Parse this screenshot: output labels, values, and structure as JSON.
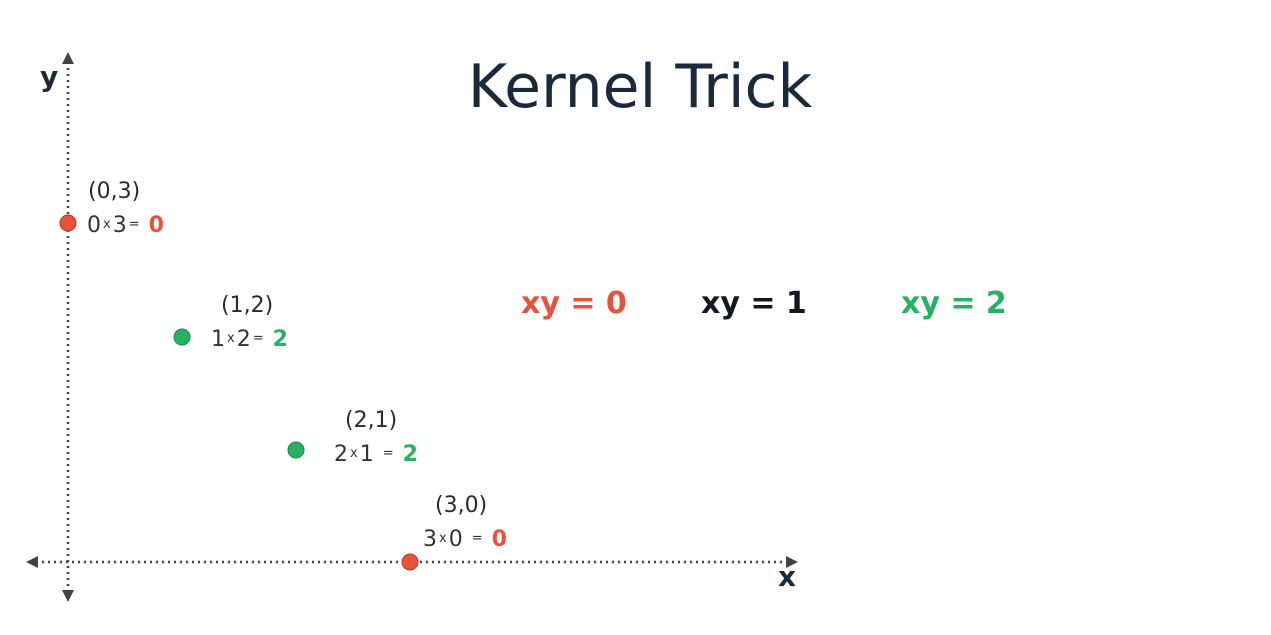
{
  "title": "Kernel Trick",
  "colors": {
    "red": "#e8513a",
    "green": "#27b262",
    "dark": "#1b2a3a",
    "axis": "#444444"
  },
  "axes": {
    "x_label": "x",
    "y_label": "y"
  },
  "points": [
    {
      "coord": "(0,3)",
      "a": "0",
      "b": "3",
      "op": "x",
      "eq": "=",
      "result": "0",
      "color": "red"
    },
    {
      "coord": "(1,2)",
      "a": "1",
      "b": "2",
      "op": "x",
      "eq": "=",
      "result": "2",
      "color": "green"
    },
    {
      "coord": "(2,1)",
      "a": "2",
      "b": "1",
      "op": "x",
      "eq": "=",
      "result": "2",
      "color": "green"
    },
    {
      "coord": "(3,0)",
      "a": "3",
      "b": "0",
      "op": "x",
      "eq": "=",
      "result": "0",
      "color": "red"
    }
  ],
  "legend": [
    {
      "text": "xy = 0",
      "color": "red"
    },
    {
      "text": "xy = 1",
      "color": "dark"
    },
    {
      "text": "xy = 2",
      "color": "green"
    }
  ]
}
